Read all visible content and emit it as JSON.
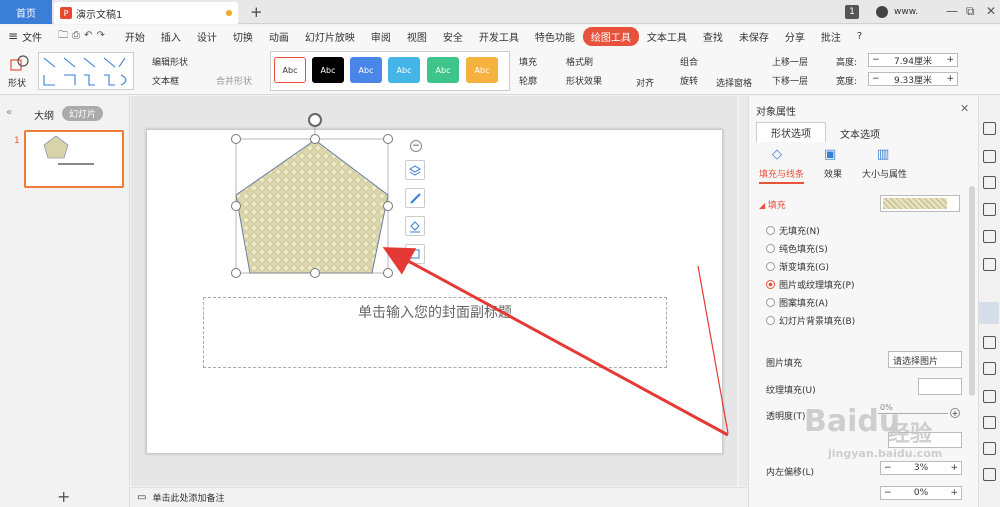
{
  "tabs": {
    "home": "首页",
    "doc": "演示文稿1",
    "new": "+"
  },
  "window": {
    "badge": "1",
    "user": "www.",
    "min": "—",
    "restore": "⧉",
    "close": "✕"
  },
  "menu": {
    "file": "文件",
    "items": [
      "开始",
      "插入",
      "设计",
      "切换",
      "动画",
      "幻灯片放映",
      "审阅",
      "视图",
      "安全",
      "开发工具",
      "特色功能"
    ],
    "active": "绘图工具",
    "text_tools": "文本工具",
    "search": "查找",
    "unsaved": "未保存",
    "share": "分享",
    "annotate": "批注",
    "help": "?"
  },
  "ribbon": {
    "shape": "形状",
    "edit_shape": "编辑形状",
    "text_box": "文本框",
    "merge_shape": "合并形状",
    "style_label": "Abc",
    "fill": "填充",
    "format_brush": "格式刷",
    "outline": "轮廓",
    "shape_effect": "形状效果",
    "align": "对齐",
    "group": "组合",
    "rotate": "旋转",
    "select_pane": "选择窗格",
    "bring_forward": "上移一层",
    "send_backward": "下移一层",
    "height_label": "高度:",
    "height_value": "7.94厘米",
    "width_label": "宽度:",
    "width_value": "9.33厘米"
  },
  "left": {
    "outline": "大纲",
    "slides": "幻灯片",
    "slide_num": "1",
    "add": "+"
  },
  "slide": {
    "subtitle_placeholder": "单击输入您的封面副标题"
  },
  "notes": {
    "placeholder": "单击此处添加备注"
  },
  "panel": {
    "title": "对象属性",
    "tab_shape": "形状选项",
    "tab_text": "文本选项",
    "sub_fill": "填充与线条",
    "sub_effect": "效果",
    "sub_size": "大小与属性",
    "section_fill": "填充",
    "options": [
      "无填充(N)",
      "纯色填充(S)",
      "渐变填充(G)",
      "图片或纹理填充(P)",
      "图案填充(A)",
      "幻灯片背景填充(B)"
    ],
    "selected_index": 3,
    "picture_fill_label": "图片填充",
    "picture_fill_value": "请选择图片",
    "texture_label": "纹理填充(U)",
    "transparency_label": "透明度(T)",
    "transparency_value": "0%",
    "offset_left_label": "内左偏移(L)",
    "offset_left_value": "3%",
    "offset_right_value": "0%"
  },
  "watermark": {
    "brand": "Baidu",
    "sub": "经验",
    "url": "jingyan.baidu.com"
  },
  "colors": {
    "accent": "#e8513a",
    "blue": "#3b7ed6",
    "arrow": "#e53935",
    "pentagon": "#d8d3a8"
  }
}
